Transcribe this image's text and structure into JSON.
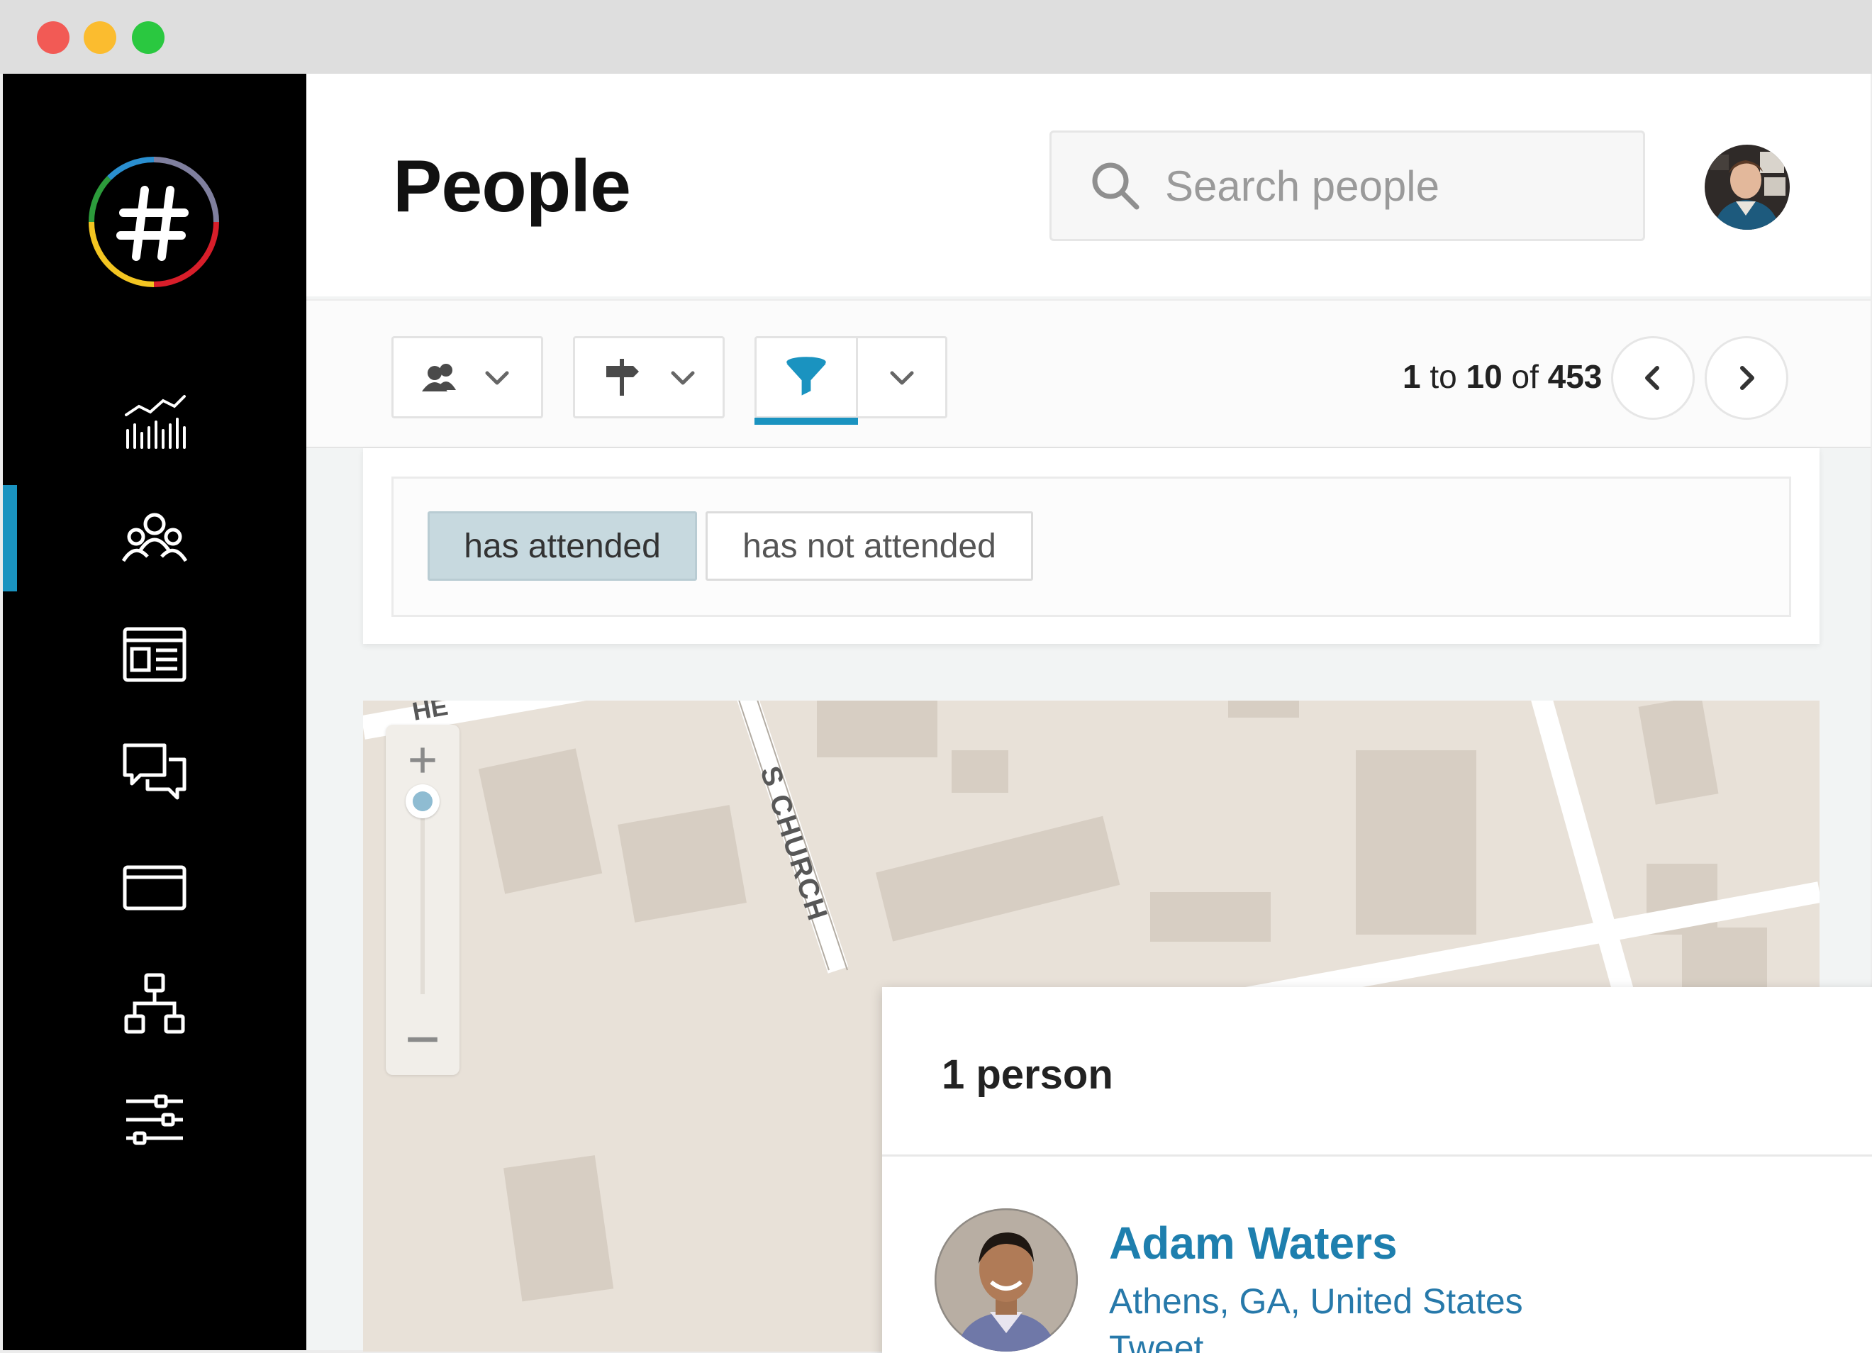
{
  "app": {
    "page_title": "People",
    "search": {
      "placeholder": "Search people"
    }
  },
  "sidebar": {
    "items": [
      {
        "icon": "analytics-icon",
        "active": false
      },
      {
        "icon": "people-icon",
        "active": true
      },
      {
        "icon": "newsletter-icon",
        "active": false
      },
      {
        "icon": "conversations-icon",
        "active": false
      },
      {
        "icon": "card-icon",
        "active": false
      },
      {
        "icon": "network-icon",
        "active": false
      },
      {
        "icon": "settings-sliders-icon",
        "active": false
      }
    ]
  },
  "toolbar": {
    "pager": {
      "from": "1",
      "to_word": "to",
      "to": "10",
      "of_word": "of",
      "total": "453"
    }
  },
  "filters": {
    "chips": [
      {
        "label": "has attended",
        "selected": true
      },
      {
        "label": "has not attended",
        "selected": false
      }
    ]
  },
  "map": {
    "street_labels": [
      "S CHURCH",
      "HE"
    ]
  },
  "popup": {
    "title": "1 person",
    "person": {
      "name": "Adam Waters",
      "location": "Athens, GA, United States",
      "action": "Tweet"
    }
  },
  "colors": {
    "accent": "#1a93c0",
    "link": "#1e7fae",
    "sidebar_bg": "#000000",
    "chip_selected": "#c7d9df"
  }
}
